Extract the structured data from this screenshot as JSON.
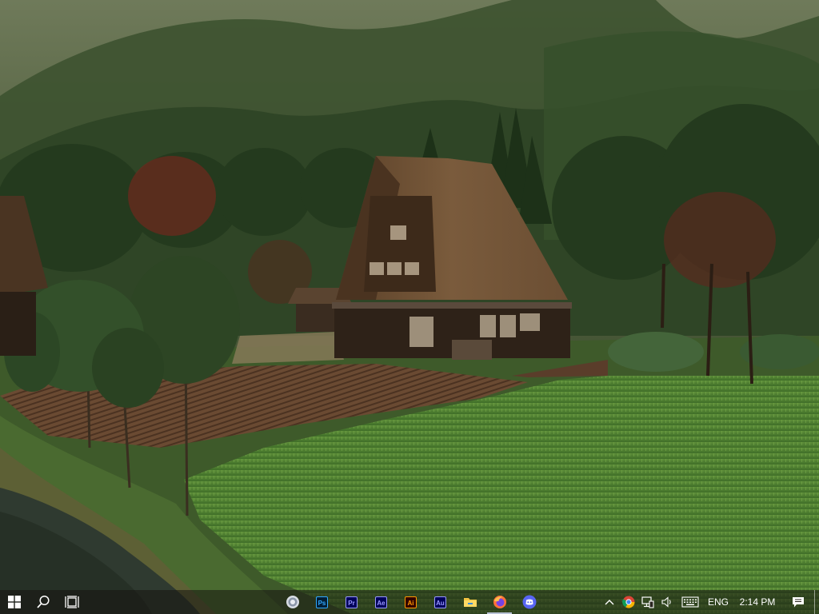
{
  "taskbar": {
    "start_label": "Start",
    "apps": [
      {
        "name": "app-cleaner",
        "abbr": ""
      },
      {
        "name": "photoshop",
        "abbr": "Ps",
        "bg": "#001e36",
        "fg": "#31a8ff"
      },
      {
        "name": "premiere-pro",
        "abbr": "Pr",
        "bg": "#00005b",
        "fg": "#9999ff"
      },
      {
        "name": "after-effects",
        "abbr": "Ae",
        "bg": "#00005b",
        "fg": "#9999ff"
      },
      {
        "name": "illustrator",
        "abbr": "Ai",
        "bg": "#330000",
        "fg": "#ff9a00"
      },
      {
        "name": "audition",
        "abbr": "Au",
        "bg": "#00005b",
        "fg": "#9999ff"
      },
      {
        "name": "file-explorer",
        "abbr": ""
      },
      {
        "name": "firefox",
        "abbr": ""
      },
      {
        "name": "discord",
        "abbr": ""
      }
    ],
    "tray": {
      "language": "ENG",
      "time": "2:14 PM"
    }
  },
  "colors": {
    "taskbar_bg": "#16140f",
    "active_indicator": "#b9c3d6"
  }
}
